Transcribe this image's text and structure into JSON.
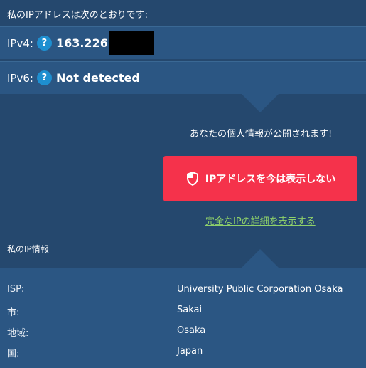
{
  "heading": "私のIPアドレスは次のとおりです:",
  "ipv4": {
    "label": "IPv4:",
    "help": "?",
    "value": "163.226"
  },
  "ipv6": {
    "label": "IPv6:",
    "help": "?",
    "value": "Not detected"
  },
  "exposed_message": "あなたの個人情報が公開されます!",
  "hide_button": {
    "label": "IPアドレスを今は表示しない",
    "color": "#f5324b",
    "icon": "shield-icon"
  },
  "details_link": "完全なIPの詳細を表示する",
  "ip_info": {
    "title": "私のIP情報",
    "rows": [
      {
        "key": "ISP:",
        "value": "University Public Corporation Osaka"
      },
      {
        "key": "市:",
        "value": "Sakai"
      },
      {
        "key": "地域:",
        "value": "Osaka"
      },
      {
        "key": "国:",
        "value": "Japan"
      }
    ]
  },
  "colors": {
    "background": "#25486e",
    "panel": "#2b5683",
    "accent_help": "#1e8fd0",
    "link_green": "#8fd16a"
  }
}
